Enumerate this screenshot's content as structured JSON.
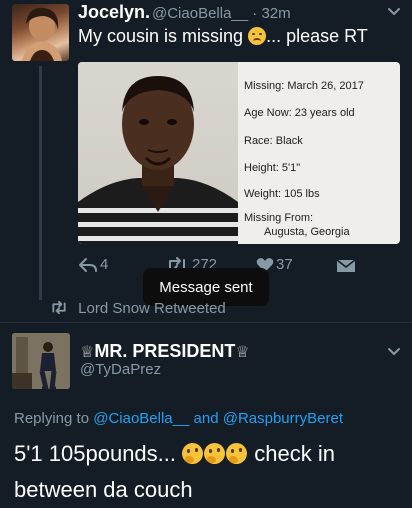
{
  "tweet": {
    "author_name": "Jocelyn.",
    "author_handle": "@CiaoBella__",
    "timestamp_sep": "·",
    "timestamp": "32m",
    "text_before_emoji": "My cousin is missing",
    "emoji_name": "disappointed-face-emoji",
    "text_after_emoji": "... please RT",
    "photo": {
      "missing": "Missing: March 26, 2017",
      "age_now": "Age Now: 23 years old",
      "race": "Race: Black",
      "height": "Height: 5'1\"",
      "weight": "Weight: 105 lbs",
      "missing_from": "Missing From:",
      "location": "Augusta, Georgia"
    },
    "actions": {
      "reply_count": "4",
      "retweet_count": "272",
      "like_count": "37"
    }
  },
  "toast": {
    "message": "Message sent"
  },
  "retweeted_by": {
    "text": "Lord Snow Retweeted"
  },
  "reply": {
    "author_crown_left": "♕",
    "author_name": "MR. PRESIDENT",
    "author_crown_right": "♕",
    "author_handle": "@TyDaPrez",
    "replying_to_prefix": "Replying to",
    "replying_to_1": "@CiaoBella__",
    "replying_to_and": "and",
    "replying_to_2": "@RaspburryBeret",
    "text_before_emoji": "5'1 105pounds...",
    "emoji_name": "thinking-face-emoji",
    "emoji_count": 3,
    "text_after_emoji": "check in between da couch"
  },
  "colors": {
    "background": "#141d26",
    "secondary_text": "#8899a6",
    "link": "#1da1f2"
  }
}
